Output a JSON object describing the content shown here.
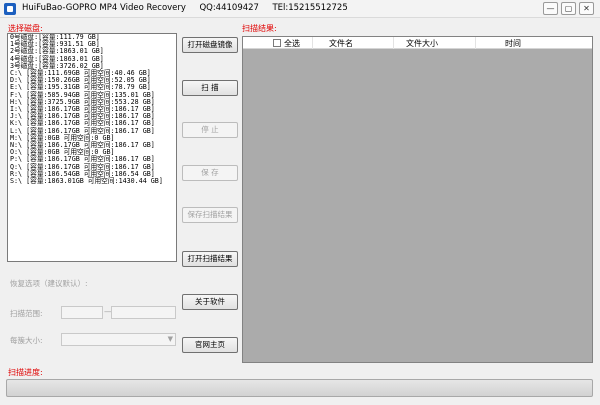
{
  "window": {
    "title": "HuiFuBao-GOPRO MP4 Video Recovery     QQ:44109427     TEl:15215512725",
    "min_label": "—",
    "max_label": "▢",
    "close_label": "✕"
  },
  "left": {
    "section_label": "选择磁盘:",
    "disks": [
      "0号磁盘:[容量:111.79 GB]",
      "1号磁盘:[容量:931.51 GB]",
      "2号磁盘:[容量:1863.01 GB]",
      "4号磁盘:[容量:1863.01 GB]",
      "3号磁盘:[容量:3726.02 GB]",
      "C:\\ [容量:111.69GB 可用空间:40.46 GB]",
      "D:\\ [容量:150.26GB 可用空间:52.05 GB]",
      "E:\\ [容量:195.31GB 可用空间:78.79 GB]",
      "F:\\ [容量:585.94GB 可用空间:135.01 GB]",
      "H:\\ [容量:3725.9GB 可用空间:553.28 GB]",
      "I:\\ [容量:186.17GB 可用空间:186.17 GB]",
      "J:\\ [容量:186.17GB 可用空间:186.17 GB]",
      "K:\\ [容量:186.17GB 可用空间:186.17 GB]",
      "L:\\ [容量:186.17GB 可用空间:186.17 GB]",
      "M:\\ [容量:0GB 可用空间:0 GB]",
      "N:\\ [容量:186.17GB 可用空间:186.17 GB]",
      "O:\\ [容量:0GB 可用空间:0 GB]",
      "P:\\ [容量:186.17GB 可用空间:186.17 GB]",
      "Q:\\ [容量:186.17GB 可用空间:186.17 GB]",
      "R:\\ [容量:186.54GB 可用空间:186.54 GB]",
      "S:\\ [容量:1863.01GB 可用空间:1430.44 GB]"
    ],
    "recovery_options_label": "恢复选项（建议默认）:",
    "scan_range_label": "扫描范围:",
    "range_dash": "—",
    "cluster_size_label": "每簇大小:"
  },
  "buttons": {
    "open_image": "打开磁盘镜像",
    "scan": "扫    描",
    "stop": "停    止",
    "save": "保    存",
    "save_results": "保存扫描结果",
    "open_results": "打开扫描结果",
    "about": "关于软件",
    "website": "官网主页"
  },
  "right": {
    "section_label": "扫描结果:",
    "columns": {
      "select_all": "全选",
      "filename": "文件名",
      "filesize": "文件大小",
      "time": "时间"
    }
  },
  "progress": {
    "label": "扫描进度:",
    "value": 0
  }
}
